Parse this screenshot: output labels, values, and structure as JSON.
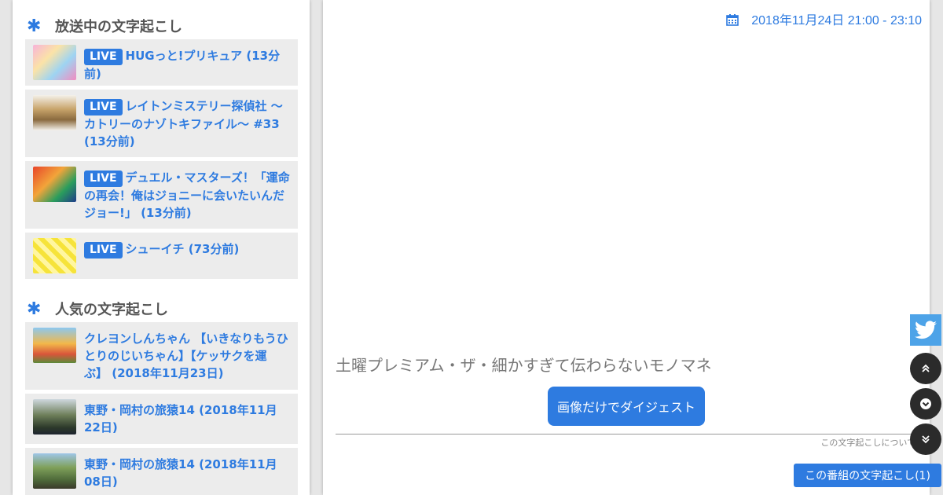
{
  "sidebar": {
    "live_section": {
      "title": "放送中の文字起こし",
      "items": [
        {
          "badge": "LIVE",
          "text": "HUGっと!プリキュア (13分前)"
        },
        {
          "badge": "LIVE",
          "text": "レイトンミステリー探偵社 ～カトリーのナゾトキファイル～ #33 (13分前)"
        },
        {
          "badge": "LIVE",
          "text": "デュエル・マスターズ！「運命の再会！俺はジョニーに会いたいんだジョー!」 (13分前)"
        },
        {
          "badge": "LIVE",
          "text": "シューイチ (73分前)"
        }
      ]
    },
    "popular_section": {
      "title": "人気の文字起こし",
      "items": [
        {
          "text": "クレヨンしんちゃん 【いきなりもうひとりのじいちゃん】【ケッサクを運ぶ】 (2018年11月23日)"
        },
        {
          "text": "東野・岡村の旅猿14 (2018年11月22日)"
        },
        {
          "text": "東野・岡村の旅猿14 (2018年11月08日)"
        }
      ]
    }
  },
  "main": {
    "date": "2018年11月24日 21:00 - 23:10",
    "program_title": "土曜プレミアム・ザ・細かすぎて伝わらないモノマネ",
    "digest_button": "画像だけでダイジェスト",
    "about_link": "この文字起こしについて",
    "bottom_button": "この番組の文字起こし(1)"
  },
  "colors": {
    "accent": "#2e7be0",
    "twitter": "#4da3e8"
  }
}
